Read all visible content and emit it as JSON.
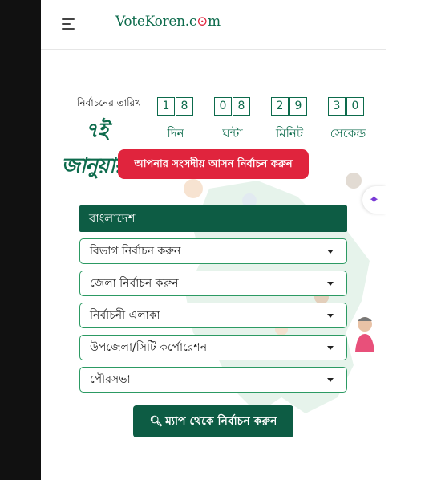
{
  "header": {
    "logo_main": "VoteKoren.c",
    "logo_o": "⊙",
    "logo_end": "m"
  },
  "election": {
    "date_label": "নির্বাচনের তারিখ",
    "date_value": "৭ই জানুয়ারী"
  },
  "countdown": [
    {
      "digits": [
        "1",
        "8"
      ],
      "label": "দিন"
    },
    {
      "digits": [
        "0",
        "8"
      ],
      "label": "ঘন্টা"
    },
    {
      "digits": [
        "2",
        "9"
      ],
      "label": "মিনিট"
    },
    {
      "digits": [
        "3",
        "0"
      ],
      "label": "সেকেন্ড"
    }
  ],
  "choose_seat_button": "আপনার সংসদীয় আসন নির্বাচন করুন",
  "country_heading": "বাংলাদেশ",
  "selects": {
    "division": "বিভাগ নির্বাচন করুন",
    "district": "জেলা নির্বাচন করুন",
    "constituency": "নির্বাচনী এলাকা",
    "upazila": "উপজেলা/সিটি কর্পোরেশন",
    "municipality": "পৌরসভা"
  },
  "map_button": "ম্যাপ থেকে নির্বাচন করুন",
  "colors": {
    "brand_green": "#0d6b4c",
    "dark_green": "#0d5c44",
    "accent_red": "#e0243d",
    "sparkle_purple": "#7a3bd6"
  }
}
